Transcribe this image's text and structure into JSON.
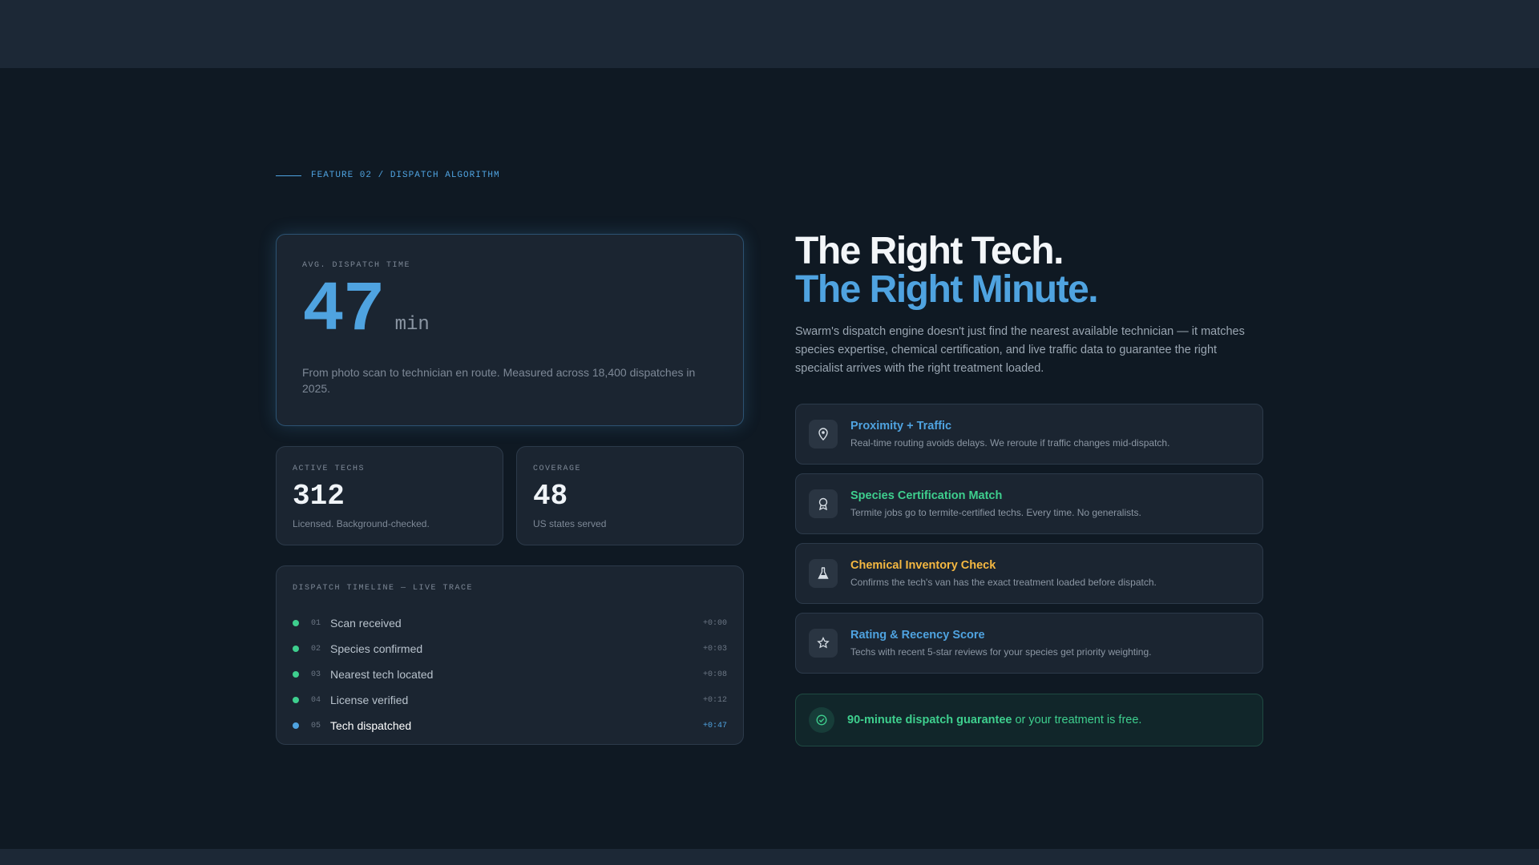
{
  "eyebrow": "FEATURE 02 / DISPATCH ALGORITHM",
  "hero": {
    "label": "AVG. DISPATCH TIME",
    "value": "47",
    "unit": "min",
    "description": "From photo scan to technician en route. Measured across 18,400 dispatches in 2025."
  },
  "stats": [
    {
      "label": "ACTIVE TECHS",
      "value": "312",
      "sub": "Licensed. Background-checked."
    },
    {
      "label": "COVERAGE",
      "value": "48",
      "sub": "US states served"
    }
  ],
  "timeline": {
    "title": "DISPATCH TIMELINE — LIVE TRACE",
    "steps": [
      {
        "num": "01",
        "label": "Scan received",
        "time": "+0:00"
      },
      {
        "num": "02",
        "label": "Species confirmed",
        "time": "+0:03"
      },
      {
        "num": "03",
        "label": "Nearest tech located",
        "time": "+0:08"
      },
      {
        "num": "04",
        "label": "License verified",
        "time": "+0:12"
      },
      {
        "num": "05",
        "label": "Tech dispatched",
        "time": "+0:47"
      }
    ]
  },
  "heading": {
    "line1": "The Right Tech.",
    "line2": "The Right Minute."
  },
  "lede": "Swarm's dispatch engine doesn't just find the nearest available technician — it matches species expertise, chemical certification, and live traffic data to guarantee the right specialist arrives with the right treatment loaded.",
  "features": [
    {
      "icon": "map-pin-icon",
      "title": "Proximity + Traffic",
      "desc": "Real-time routing avoids delays. We reroute if traffic changes mid-dispatch.",
      "color": "#4fa3e0"
    },
    {
      "icon": "badge-icon",
      "title": "Species Certification Match",
      "desc": "Termite jobs go to termite-certified techs. Every time. No generalists.",
      "color": "#3ecf8e"
    },
    {
      "icon": "flask-icon",
      "title": "Chemical Inventory Check",
      "desc": "Confirms the tech's van has the exact treatment loaded before dispatch.",
      "color": "#f5b841"
    },
    {
      "icon": "star-icon",
      "title": "Rating & Recency Score",
      "desc": "Techs with recent 5-star reviews for your species get priority weighting.",
      "color": "#4fa3e0"
    }
  ],
  "guarantee": {
    "icon": "check-circle-icon",
    "bold": "90-minute dispatch guarantee",
    "rest": " or your treatment is free."
  },
  "colors": {
    "background": "#0f1923",
    "accent": "#4fa3e0",
    "success": "#3ecf8e",
    "warning": "#f5b841"
  }
}
